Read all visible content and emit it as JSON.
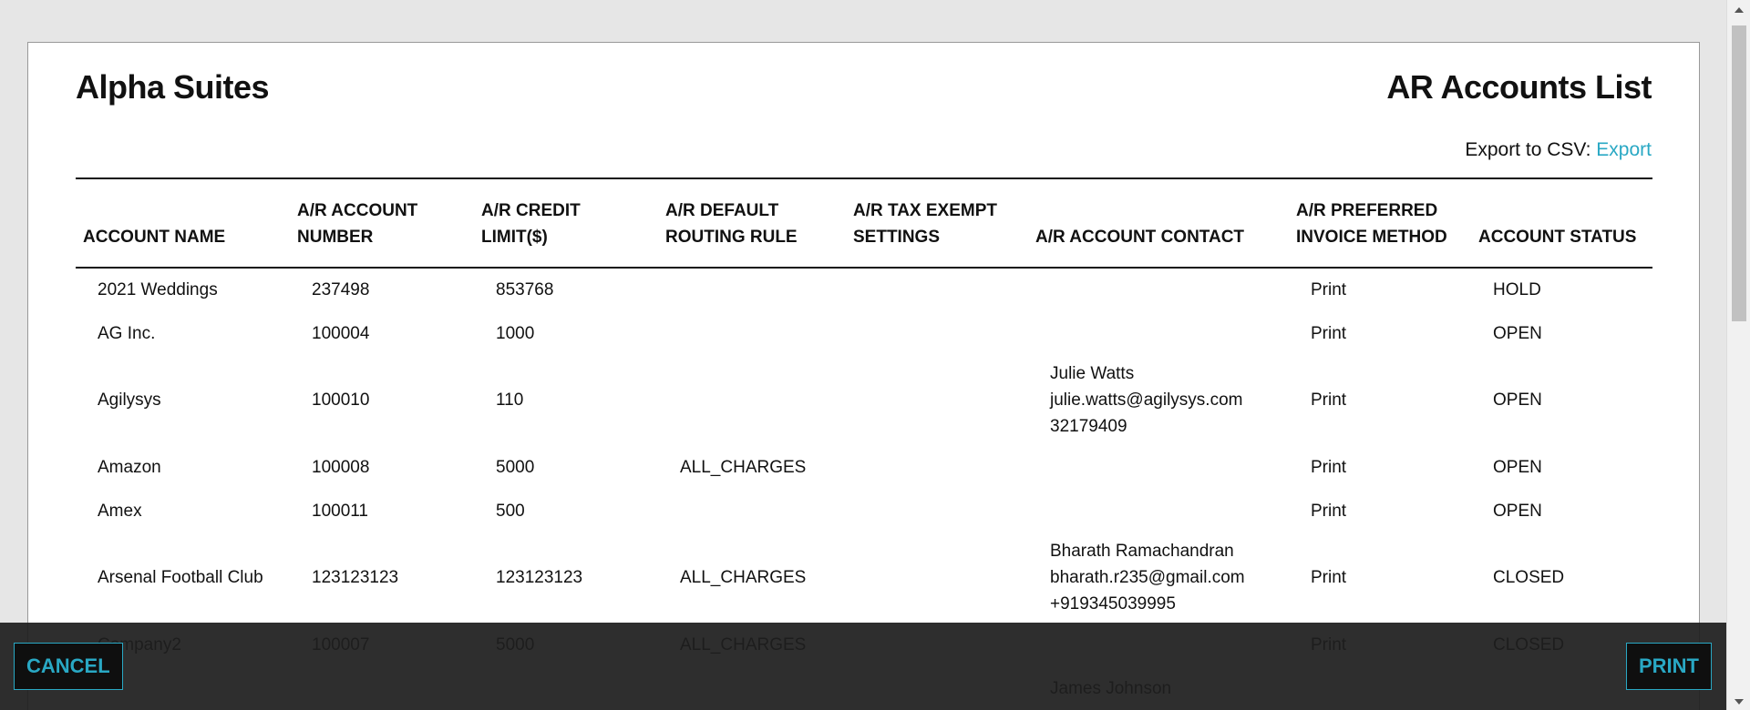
{
  "report": {
    "company": "Alpha Suites",
    "title": "AR Accounts List",
    "export_label": "Export to CSV:",
    "export_link": "Export"
  },
  "table": {
    "headers": {
      "account_name": "ACCOUNT NAME",
      "account_number_1": "A/R ACCOUNT",
      "account_number_2": "NUMBER",
      "credit_limit_1": "A/R CREDIT",
      "credit_limit_2": "LIMIT($)",
      "routing_rule_1": "A/R DEFAULT",
      "routing_rule_2": "ROUTING RULE",
      "tax_exempt_1": "A/R TAX EXEMPT",
      "tax_exempt_2": "SETTINGS",
      "contact": "A/R ACCOUNT CONTACT",
      "invoice_method_1": "A/R PREFERRED",
      "invoice_method_2": "INVOICE METHOD",
      "status": "ACCOUNT STATUS"
    },
    "rows": [
      {
        "name": "2021 Weddings",
        "number": "237498",
        "credit": "853768",
        "routing": "",
        "tax": "",
        "contact": [
          "",
          "",
          ""
        ],
        "invoice": "Print",
        "status": "HOLD"
      },
      {
        "name": "AG Inc.",
        "number": "100004",
        "credit": "1000",
        "routing": "",
        "tax": "",
        "contact": [
          "",
          "",
          ""
        ],
        "invoice": "Print",
        "status": "OPEN"
      },
      {
        "name": "Agilysys",
        "number": "100010",
        "credit": "110",
        "routing": "",
        "tax": "",
        "contact": [
          "Julie Watts",
          "julie.watts@agilysys.com",
          "32179409"
        ],
        "invoice": "Print",
        "status": "OPEN"
      },
      {
        "name": "Amazon",
        "number": "100008",
        "credit": "5000",
        "routing": "ALL_CHARGES",
        "tax": "",
        "contact": [
          "",
          "",
          ""
        ],
        "invoice": "Print",
        "status": "OPEN"
      },
      {
        "name": "Amex",
        "number": "100011",
        "credit": "500",
        "routing": "",
        "tax": "",
        "contact": [
          "",
          "",
          ""
        ],
        "invoice": "Print",
        "status": "OPEN"
      },
      {
        "name": "Arsenal Football Club",
        "number": "123123123",
        "credit": "123123123",
        "routing": "ALL_CHARGES",
        "tax": "",
        "contact": [
          "Bharath Ramachandran",
          "bharath.r235@gmail.com",
          "+919345039995"
        ],
        "invoice": "Print",
        "status": "CLOSED"
      },
      {
        "name": "Company2",
        "number": "100007",
        "credit": "5000",
        "routing": "ALL_CHARGES",
        "tax": "",
        "contact": [
          "",
          "",
          ""
        ],
        "invoice": "Print",
        "status": "CLOSED"
      },
      {
        "name": "",
        "number": "",
        "credit": "",
        "routing": "",
        "tax": "",
        "contact": [
          "James Johnson",
          "",
          ""
        ],
        "invoice": "",
        "status": ""
      }
    ]
  },
  "footer": {
    "cancel_label": "CANCEL",
    "print_label": "PRINT"
  },
  "colors": {
    "accent": "#29a8c4",
    "footer_bg": "#1e1e1e",
    "page_bg": "#e6e6e6"
  }
}
